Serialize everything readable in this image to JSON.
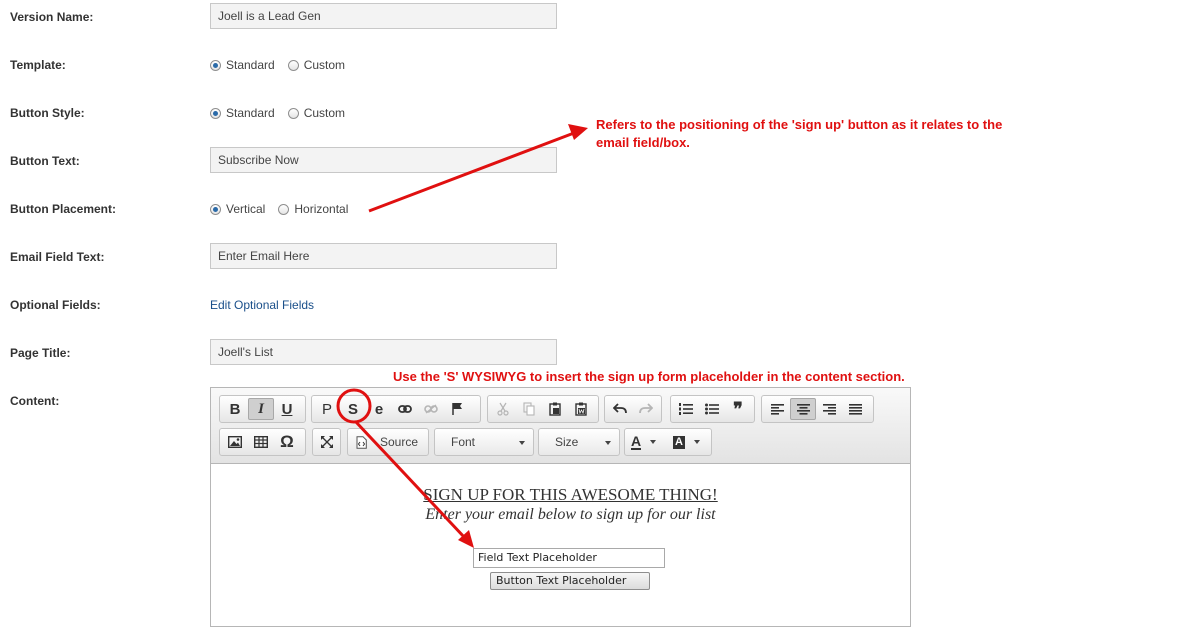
{
  "form": {
    "version_name": {
      "label": "Version Name:",
      "value": "Joell is a Lead Gen"
    },
    "template": {
      "label": "Template:",
      "options": [
        "Standard",
        "Custom"
      ],
      "selected": "Standard"
    },
    "button_style": {
      "label": "Button Style:",
      "options": [
        "Standard",
        "Custom"
      ],
      "selected": "Standard"
    },
    "button_text": {
      "label": "Button Text:",
      "value": "Subscribe Now"
    },
    "button_placement": {
      "label": "Button Placement:",
      "options": [
        "Vertical",
        "Horizontal"
      ],
      "selected": "Vertical"
    },
    "email_field_text": {
      "label": "Email Field Text:",
      "value": "Enter Email Here"
    },
    "optional_fields": {
      "label": "Optional Fields:",
      "link": "Edit Optional Fields"
    },
    "page_title": {
      "label": "Page Title:",
      "value": "Joell's List"
    },
    "content": {
      "label": "Content:"
    }
  },
  "editor": {
    "toolbar": {
      "row1": {
        "basic": [
          {
            "icon": "bold-icon",
            "glyph": "B"
          },
          {
            "icon": "italic-icon",
            "glyph": "I",
            "active": true
          },
          {
            "icon": "underline-icon",
            "glyph": "U"
          }
        ],
        "insert": [
          {
            "icon": "paragraph-icon",
            "glyph": "P"
          },
          {
            "icon": "signup-form-icon",
            "glyph": "S"
          },
          {
            "icon": "e-icon",
            "glyph": "e"
          },
          {
            "icon": "link-icon"
          },
          {
            "icon": "unlink-icon"
          },
          {
            "icon": "anchor-flag-icon"
          }
        ],
        "clipboard": [
          "cut-icon",
          "copy-icon",
          "paste-icon",
          "paste-word-icon"
        ],
        "history": [
          "undo-icon",
          "redo-icon"
        ],
        "lists": [
          "numbered-list-icon",
          "bullet-list-icon",
          "blockquote-icon"
        ],
        "align": [
          "align-left-icon",
          "align-center-icon",
          "align-right-icon",
          "align-justify-icon"
        ]
      },
      "row2": {
        "source_label": "Source",
        "font_label": "Font",
        "size_label": "Size",
        "text_color_glyph": "A",
        "bg_color_glyph": "A"
      }
    },
    "body": {
      "heading": "SIGN UP FOR THIS AWESOME THING!",
      "subheading": "Enter your email below to sign up for our list",
      "field_placeholder": "Field Text Placeholder",
      "button_placeholder": "Button Text Placeholder"
    }
  },
  "annotations": {
    "placement_note_line1": "Refers to the positioning of the 'sign up' button as it relates to the",
    "placement_note_line2": "email field/box.",
    "wysiwyg_note": "Use the 'S' WYSIWYG to insert the sign up form placeholder in the content section."
  },
  "colors": {
    "annotation": "#e01010",
    "link": "#1a4f8a",
    "radio_selected": "#2a6aa8"
  }
}
